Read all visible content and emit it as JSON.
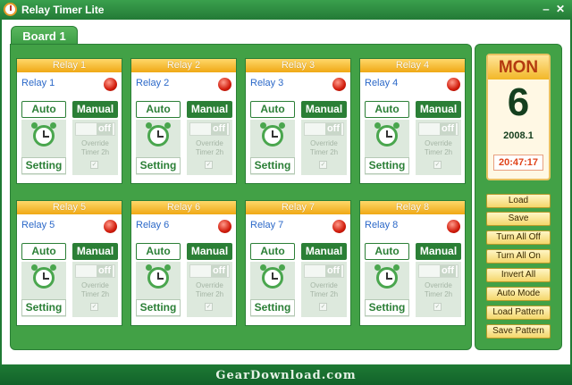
{
  "window": {
    "title": "Relay Timer Lite"
  },
  "tab": {
    "label": "Board 1"
  },
  "relays": [
    {
      "header": "Relay 1",
      "name": "Relay 1",
      "auto": "Auto",
      "manual": "Manual",
      "setting": "Setting",
      "toggle": "off",
      "override": "Override Timer 2h"
    },
    {
      "header": "Relay 2",
      "name": "Relay 2",
      "auto": "Auto",
      "manual": "Manual",
      "setting": "Setting",
      "toggle": "off",
      "override": "Override Timer 2h"
    },
    {
      "header": "Relay 3",
      "name": "Relay 3",
      "auto": "Auto",
      "manual": "Manual",
      "setting": "Setting",
      "toggle": "off",
      "override": "Override Timer 2h"
    },
    {
      "header": "Relay 4",
      "name": "Relay 4",
      "auto": "Auto",
      "manual": "Manual",
      "setting": "Setting",
      "toggle": "off",
      "override": "Override Timer 2h"
    },
    {
      "header": "Relay 5",
      "name": "Relay 5",
      "auto": "Auto",
      "manual": "Manual",
      "setting": "Setting",
      "toggle": "off",
      "override": "Override Timer 2h"
    },
    {
      "header": "Relay 6",
      "name": "Relay 6",
      "auto": "Auto",
      "manual": "Manual",
      "setting": "Setting",
      "toggle": "off",
      "override": "Override Timer 2h"
    },
    {
      "header": "Relay 7",
      "name": "Relay 7",
      "auto": "Auto",
      "manual": "Manual",
      "setting": "Setting",
      "toggle": "off",
      "override": "Override Timer 2h"
    },
    {
      "header": "Relay 8",
      "name": "Relay 8",
      "auto": "Auto",
      "manual": "Manual",
      "setting": "Setting",
      "toggle": "off",
      "override": "Override Timer 2h"
    }
  ],
  "calendar": {
    "day": "MON",
    "date": "6",
    "year_month": "2008.1",
    "time": "20:47:17"
  },
  "buttons": [
    "Load",
    "Save",
    "Turn All Off",
    "Turn All On",
    "Invert All",
    "Auto Mode",
    "Load Pattern",
    "Save Pattern"
  ],
  "watermark": "GearDownload.com",
  "colors": {
    "accent": "#42a146",
    "header": "#f0a815",
    "led": "#d11c0c"
  },
  "icons": {
    "app": "clock-icon",
    "timer": "alarm-clock-icon",
    "status": "led-icon"
  }
}
